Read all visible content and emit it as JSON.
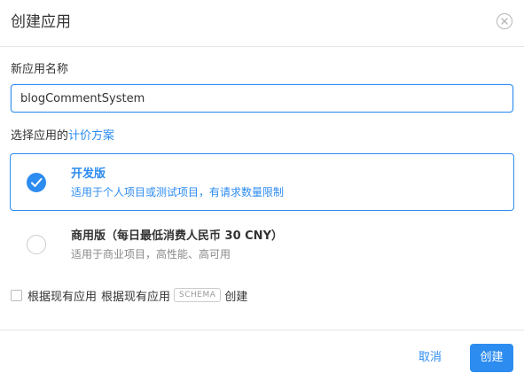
{
  "dialog": {
    "title": "创建应用",
    "close_icon": "close-circle-icon"
  },
  "form": {
    "name_label": "新应用名称",
    "name_value": "blogCommentSystem",
    "plan_heading_prefix": "选择应用的",
    "plan_heading_link": "计价方案"
  },
  "plans": [
    {
      "name": "开发版",
      "description": "适用于个人项目或测试项目，有请求数量限制",
      "selected": true
    },
    {
      "name": "商用版（每日最低消费人民币 30 CNY）",
      "description": "适用于商业项目，高性能、高可用",
      "selected": false
    }
  ],
  "schema_option": {
    "checked": false,
    "label_part1": "根据现有应用",
    "label_part2": "根据现有应用",
    "tag": "SCHEMA",
    "label_part3": "创建"
  },
  "footer": {
    "cancel_label": "取消",
    "create_label": "创建"
  },
  "colors": {
    "accent": "#2d8cf0",
    "border": "#e5e5e5",
    "muted_text": "#888888"
  }
}
